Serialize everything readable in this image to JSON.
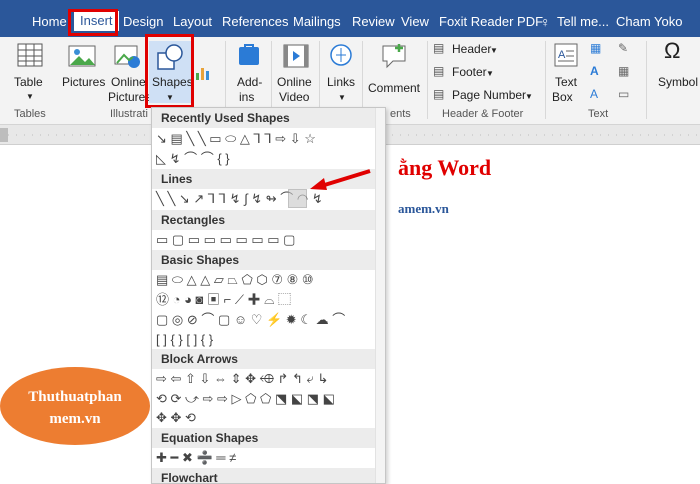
{
  "tabs": [
    {
      "label": "Home"
    },
    {
      "label": "Insert"
    },
    {
      "label": "Design"
    },
    {
      "label": "Layout"
    },
    {
      "label": "References"
    },
    {
      "label": "Mailings"
    },
    {
      "label": "Review"
    },
    {
      "label": "View"
    },
    {
      "label": "Foxit Reader PDF"
    }
  ],
  "tellme": "Tell me...",
  "user": "Cham Yoko",
  "ribbon": {
    "table": "Table",
    "pictures": "Pictures",
    "online_pictures_1": "Online",
    "online_pictures_2": "Pictures",
    "shapes": "Shapes",
    "addins_1": "Add-",
    "addins_2": "ins",
    "online_video_1": "Online",
    "online_video_2": "Video",
    "links": "Links",
    "comment": "Comment",
    "header": "Header",
    "footer": "Footer",
    "page_number": "Page Number",
    "textbox_1": "Text",
    "textbox_2": "Box",
    "symbols": "Symbol",
    "groups": {
      "tables": "Tables",
      "illustrations": "Illustrati",
      "comments": "ents",
      "header_footer": "Header & Footer",
      "text": "Text"
    }
  },
  "shapes_menu": {
    "sections": {
      "recent": "Recently Used Shapes",
      "lines": "Lines",
      "rectangles": "Rectangles",
      "basic": "Basic Shapes",
      "block_arrows": "Block Arrows",
      "equation": "Equation Shapes",
      "flowchart": "Flowchart"
    },
    "rows": {
      "recent_1": "↘ ▤ ╲ ╲ ▭ ⬭ △ ⅂ ⅂ ⇨ ⇩ ☆",
      "recent_2": "◺ ↯ ⌒ ⌒ { }",
      "lines": "╲ ╲ ↘ ↗ ⅂ ⅂ ↯ ∫ ↯ ↬ ⌒ ◠ ↯",
      "rectangles": "▭ ▢ ▭ ▭ ▭ ▭ ▭ ▭ ▢",
      "basic_1": "▤ ⬭ △ △ ▱ ⏢ ⬠ ⬡ ⑦ ⑧ ⑩",
      "basic_2": "⑫ ◔ ◕ ◙ ▣ ⌐ ⟋ ✚ ⌓ ⬚",
      "basic_3": "▢ ◎ ⊘ ⌒ ▢ ☺ ♡ ⚡ ✹ ☾ ☁ ⌒",
      "basic_4": "[ ] { } [ ] { }",
      "arrows_1": "⇨ ⇦ ⇧ ⇩ ⇔ ⇕ ✥ ⬲ ↱ ↰ ⤶ ↳",
      "arrows_2": "⟲ ⟳ ⤻ ⇨ ⇨ ▷ ⬠ ⬠ ⬔ ⬕ ⬔ ⬕",
      "arrows_3": "✥ ✥ ⟲",
      "equation": "✚ ━ ✖ ➗ ═ ≠"
    }
  },
  "document": {
    "heading": "ằng Word",
    "subheading": "amem.vn",
    "oval_text_1": "Thuthuatphan",
    "oval_text_2": "mem.vn"
  }
}
